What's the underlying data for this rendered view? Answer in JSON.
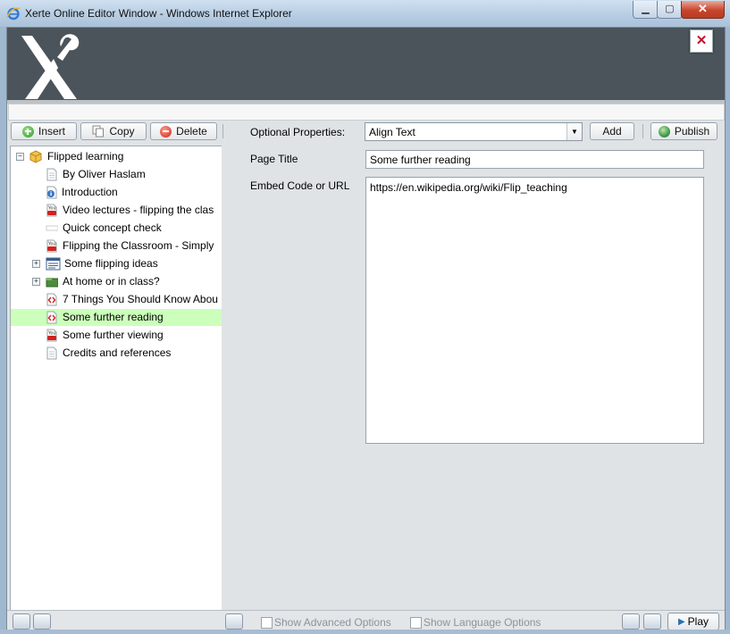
{
  "window": {
    "title": "Xerte Online Editor Window - Windows Internet Explorer",
    "minimize_icon": "minimize-icon",
    "maximize_icon": "maximize-icon",
    "close_glyph": "✕"
  },
  "banner": {
    "logo_icon": "xerte-wrench-logo",
    "close_glyph": "✕"
  },
  "toolbar": {
    "insert_label": "Insert",
    "copy_label": "Copy",
    "delete_label": "Delete",
    "optional_properties_label": "Optional Properties:",
    "optional_properties_selected": "Align Text",
    "add_label": "Add",
    "publish_label": "Publish"
  },
  "tree": {
    "root": {
      "label": "Flipped learning",
      "icon": "package-icon",
      "expander": "⊟"
    },
    "items": [
      {
        "label": "By Oliver Haslam",
        "icon": "page-icon"
      },
      {
        "label": "Introduction",
        "icon": "info-icon"
      },
      {
        "label": "Video lectures - flipping the clas",
        "icon": "youtube-icon"
      },
      {
        "label": "Quick concept check",
        "icon": "blank-icon"
      },
      {
        "label": "Flipping the Classroom - Simply",
        "icon": "youtube-icon"
      },
      {
        "label": "Some flipping ideas",
        "icon": "list-page-icon",
        "expander": "⊞"
      },
      {
        "label": "At home or in class?",
        "icon": "folder-icon",
        "expander": "⊞"
      },
      {
        "label": "7 Things You Should Know Abou",
        "icon": "embed-icon"
      },
      {
        "label": "Some further reading",
        "icon": "embed-icon",
        "selected": true
      },
      {
        "label": "Some further viewing",
        "icon": "youtube-icon"
      },
      {
        "label": "Credits and references",
        "icon": "page-icon"
      }
    ]
  },
  "properties": {
    "page_title_label": "Page Title",
    "page_title_value": "Some further reading",
    "embed_label": "Embed Code or URL",
    "embed_value": "https://en.wikipedia.org/wiki/Flip_teaching"
  },
  "bottom": {
    "show_advanced_label": "Show Advanced Options",
    "show_language_label": "Show Language Options",
    "play_label": "Play"
  },
  "colors": {
    "banner": "#4c545b",
    "selected_row": "#ccffbb",
    "panel": "#dfe3e6"
  }
}
